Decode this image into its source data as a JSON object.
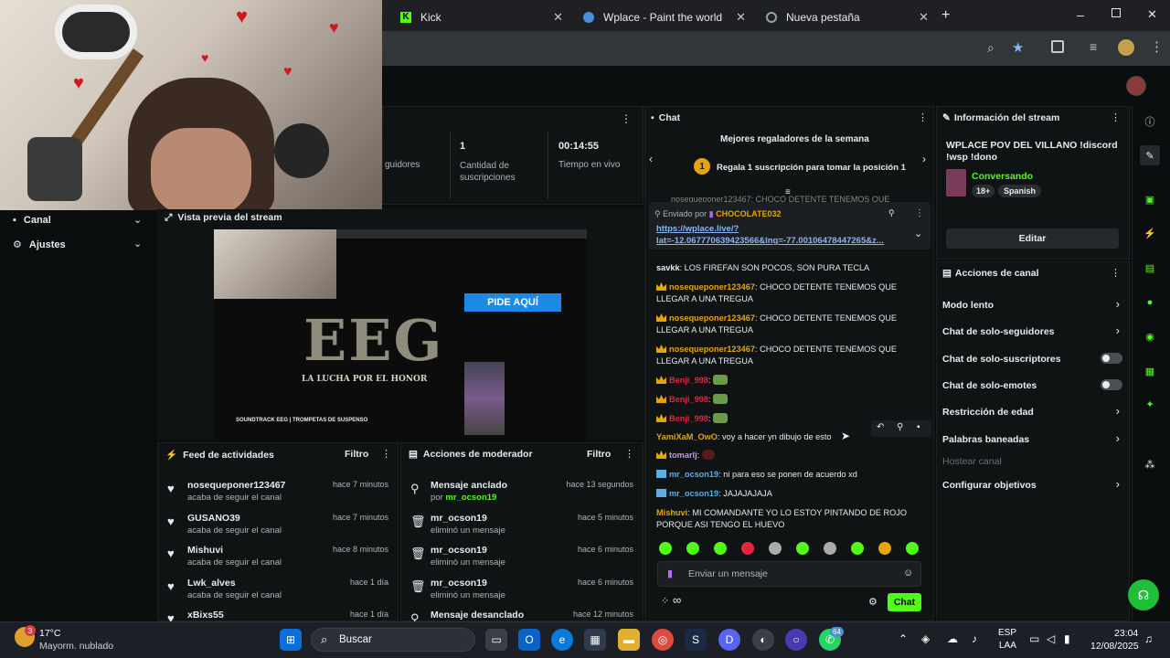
{
  "browser": {
    "tabs": [
      {
        "label": "Kick"
      },
      {
        "label": "Wplace - Paint the world"
      },
      {
        "label": "Nueva pestaña"
      }
    ],
    "new_tab": "+",
    "close": "✕"
  },
  "webcam": {
    "description_icon": "webcam-feed"
  },
  "sidebar": {
    "items": [
      {
        "label": "Canal"
      },
      {
        "label": "Ajustes"
      }
    ]
  },
  "stats": {
    "partial_label": "guidores",
    "subs_value": "1",
    "subs_label": "Cantidad de suscripciones",
    "time_value": "00:14:55",
    "time_label": "Tiempo en vivo"
  },
  "preview": {
    "title": "Vista previa del stream",
    "inner_button": "PIDE AQUÍ",
    "inner_logo": "EEG",
    "inner_tagline": "LA LUCHA POR EL HONOR",
    "inner_caption": "SOUNDTRACK EEG | TROMPETAS DE SUSPENSO"
  },
  "activity": {
    "title": "Feed de actividades",
    "filter": "Filtro",
    "items": [
      {
        "name": "nosequeponer123467",
        "sub": "acaba de seguir el canal",
        "time": "hace 7 minutos"
      },
      {
        "name": "GUSANO39",
        "sub": "acaba de seguir el canal",
        "time": "hace 7 minutos"
      },
      {
        "name": "Mishuvi",
        "sub": "acaba de seguir el canal",
        "time": "hace 8 minutos"
      },
      {
        "name": "Lwk_alves",
        "sub": "acaba de seguir el canal",
        "time": "hace 1 día"
      },
      {
        "name": "xBixs55",
        "sub": "",
        "time": "hace 1 día"
      }
    ]
  },
  "modactions": {
    "title": "Acciones de moderador",
    "filter": "Filtro",
    "items": [
      {
        "name": "Mensaje anclado",
        "sub_prefix": "por",
        "sub_user": "mr_ocson19",
        "time": "hace 13 segundos"
      },
      {
        "name": "mr_ocson19",
        "sub": "eliminó un mensaje",
        "time": "hace 5 minutos"
      },
      {
        "name": "mr_ocson19",
        "sub": "eliminó un mensaje",
        "time": "hace 6 minutos"
      },
      {
        "name": "mr_ocson19",
        "sub": "eliminó un mensaje",
        "time": "hace 6 minutos"
      },
      {
        "name": "Mensaje desanclado",
        "sub": "",
        "time": "hace 12 minutos"
      }
    ]
  },
  "chat": {
    "title": "Chat",
    "leaderboard_title": "Mejores regaladores de la semana",
    "leaderboard_rank": "1",
    "leaderboard_cta": "Regala 1 suscripción para tomar la posición 1",
    "truncated_line": "nosequeponer123467: CHOCO DETENTE TENEMOS QUE",
    "pinned_by": "Enviado por",
    "pinned_user": "CHOCOLATE032",
    "pinned_link_1": "https://wplace.live/?",
    "pinned_link_2": "lat=-12.067770639423566&lng=-77.00106478447265&z...",
    "messages": [
      {
        "user": "savkk",
        "color": "#e8eaed",
        "badge": "",
        "text": "LOS FIREFAN SON POCOS, SON PURA TECLA"
      },
      {
        "user": "nosequeponer123467",
        "color": "#e5a50a",
        "badge": "crown",
        "text": "CHOCO DETENTE TENEMOS QUE LLEGAR A UNA TREGUA"
      },
      {
        "user": "nosequeponer123467",
        "color": "#e5a50a",
        "badge": "crown",
        "text": "CHOCO DETENTE TENEMOS QUE LLEGAR A UNA TREGUA"
      },
      {
        "user": "nosequeponer123467",
        "color": "#e5a50a",
        "badge": "crown",
        "text": "CHOCO DETENTE TENEMOS QUE LLEGAR A UNA TREGUA"
      },
      {
        "user": "Benji_998",
        "color": "#e2263b",
        "badge": "crown",
        "text": ""
      },
      {
        "user": "Benji_998",
        "color": "#e2263b",
        "badge": "crown",
        "text": ""
      },
      {
        "user": "Benji_998",
        "color": "#e2263b",
        "badge": "crown",
        "text": ""
      },
      {
        "user": "YamiXaM_OwO",
        "color": "#e5a50a",
        "badge": "",
        "text": "voy a hacer yn dibujo de esto"
      },
      {
        "user": "tomarlj",
        "color": "#c39bd3",
        "badge": "crown",
        "text": ""
      },
      {
        "user": "mr_ocson19",
        "color": "#5dade2",
        "badge": "mod",
        "text": "ni para eso se ponen de acuerdo xd"
      },
      {
        "user": "mr_ocson19",
        "color": "#5dade2",
        "badge": "mod",
        "text": "JAJAJAJAJA"
      },
      {
        "user": "Mishuvi",
        "color": "#e5a50a",
        "badge": "",
        "text": "MI COMANDANTE YO LO ESTOY PINTANDO DE ROJO PORQUE ASI TENGO EL HUEVO"
      }
    ],
    "input_placeholder": "Enviar un mensaje",
    "send": "Chat",
    "infinity": "∞"
  },
  "streaminfo": {
    "title": "Información del stream",
    "stream_title": "WPLACE POV DEL VILLANO !discord !wsp !dono",
    "category": "Conversando",
    "tags": [
      "18+",
      "Spanish"
    ],
    "edit": "Editar"
  },
  "channelactions": {
    "title": "Acciones de canal",
    "items": [
      {
        "label": "Modo lento",
        "control": "chevron"
      },
      {
        "label": "Chat de solo-seguidores",
        "control": "chevron"
      },
      {
        "label": "Chat de solo-suscriptores",
        "control": "toggle"
      },
      {
        "label": "Chat de solo-emotes",
        "control": "toggle"
      },
      {
        "label": "Restricción de edad",
        "control": "chevron"
      },
      {
        "label": "Palabras baneadas",
        "control": "chevron"
      },
      {
        "label": "Hostear canal",
        "control": "none"
      },
      {
        "label": "Configurar objetivos",
        "control": "chevron"
      }
    ]
  },
  "taskbar": {
    "weather_temp": "17°C",
    "weather_desc": "Mayorm. nublado",
    "weather_badge": "3",
    "search": "Buscar",
    "lang": "ESP",
    "lang2": "LAA",
    "time": "23:04",
    "date": "12/08/2025",
    "whatsapp_badge": "64"
  },
  "colors": {
    "kick_green": "#53fc18",
    "bg": "#0b0e0f",
    "panel": "#0f1314"
  }
}
